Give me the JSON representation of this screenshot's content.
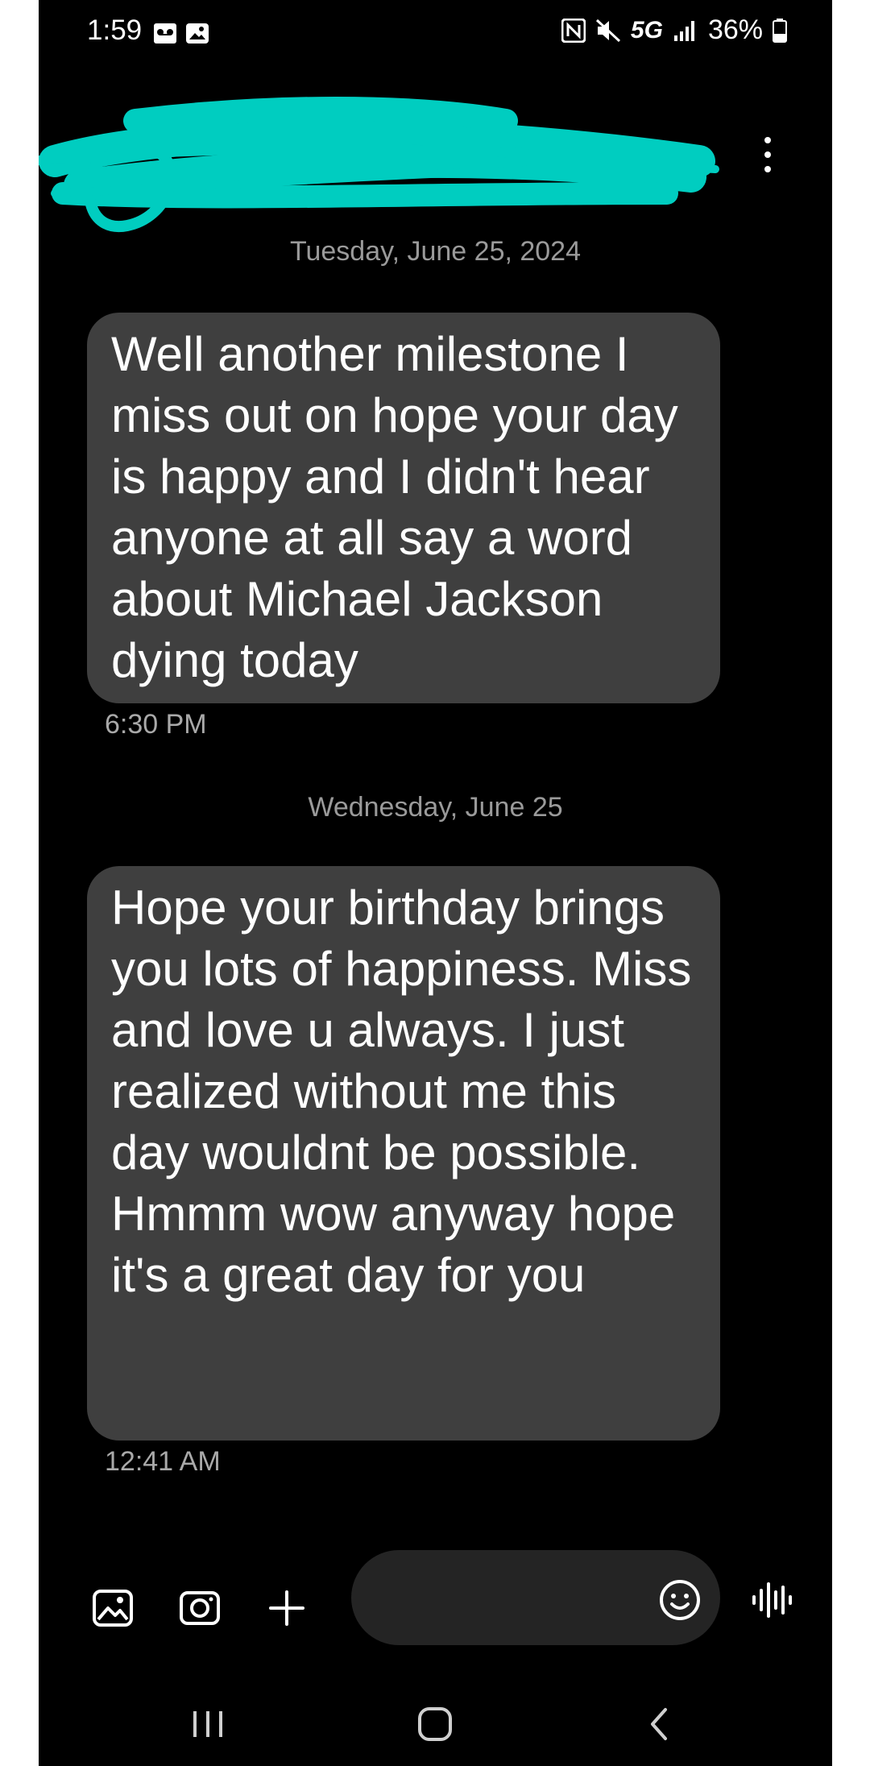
{
  "status_bar": {
    "time": "1:59",
    "network": "5G",
    "battery": "36%",
    "icons": [
      "voicemail-icon",
      "image-notification-icon",
      "nfc-icon",
      "mute-icon",
      "5g-icon",
      "signal-icon",
      "battery-icon"
    ]
  },
  "header": {
    "contact_name_redacted": true,
    "menu_icon": "more-vert-icon"
  },
  "conversation": {
    "groups": [
      {
        "date": "Tuesday, June 25, 2024",
        "message": "Well another milestone I miss out on hope your day is happy and I didn't hear anyone at all say a word about Michael Jackson dying today",
        "time": "6:30 PM"
      },
      {
        "date": "Wednesday, June 25",
        "message": "Hope your birthday brings you lots of happiness. Miss and love u always. I just realized without me this day wouldnt be possible. Hmmm wow anyway hope it's a great day for you",
        "time": "12:41 AM"
      }
    ]
  },
  "compose": {
    "tools": [
      "gallery-icon",
      "camera-icon",
      "plus-icon"
    ],
    "input_value": "",
    "emoji_icon": "emoji-icon",
    "voice_icon": "voice-wave-icon"
  },
  "navbar": {
    "buttons": [
      "recents-icon",
      "home-icon",
      "back-icon"
    ]
  },
  "colors": {
    "background": "#000000",
    "bubble": "#3f3f3f",
    "redaction": "#00cdc0",
    "secondary_text": "#9a9a9a",
    "input_bg": "#242424"
  }
}
